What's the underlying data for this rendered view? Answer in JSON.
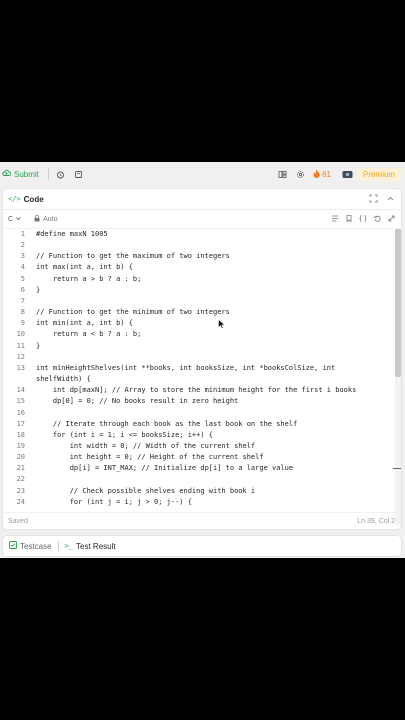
{
  "toolbar": {
    "submit_label": "Submit",
    "streak_count": "61",
    "premium_label": "Premium"
  },
  "panel": {
    "title": "Code",
    "language": "C",
    "indent_mode": "Auto"
  },
  "editor": {
    "lines": [
      {
        "n": "1",
        "t": "#define maxN 1005"
      },
      {
        "n": "2",
        "t": ""
      },
      {
        "n": "3",
        "t": "// Function to get the maximum of two integers"
      },
      {
        "n": "4",
        "t": "int max(int a, int b) {"
      },
      {
        "n": "5",
        "t": "    return a > b ? a : b;"
      },
      {
        "n": "6",
        "t": "}"
      },
      {
        "n": "7",
        "t": ""
      },
      {
        "n": "8",
        "t": "// Function to get the minimum of two integers"
      },
      {
        "n": "9",
        "t": "int min(int a, int b) {"
      },
      {
        "n": "10",
        "t": "    return a < b ? a : b;"
      },
      {
        "n": "11",
        "t": "}"
      },
      {
        "n": "12",
        "t": ""
      },
      {
        "n": "13",
        "t": "int minHeightShelves(int **books, int booksSize, int *booksColSize, int"
      },
      {
        "n": "",
        "t": "shelfWidth) {"
      },
      {
        "n": "14",
        "t": "    int dp[maxN]; // Array to store the minimum height for the first i books"
      },
      {
        "n": "15",
        "t": "    dp[0] = 0; // No books result in zero height"
      },
      {
        "n": "16",
        "t": ""
      },
      {
        "n": "17",
        "t": "    // Iterate through each book as the last book on the shelf"
      },
      {
        "n": "18",
        "t": "    for (int i = 1; i <= booksSize; i++) {"
      },
      {
        "n": "19",
        "t": "        int width = 0; // Width of the current shelf"
      },
      {
        "n": "20",
        "t": "        int height = 0; // Height of the current shelf"
      },
      {
        "n": "21",
        "t": "        dp[i] = INT_MAX; // Initialize dp[i] to a large value"
      },
      {
        "n": "22",
        "t": ""
      },
      {
        "n": "23",
        "t": "        // Check possible shelves ending with book i"
      },
      {
        "n": "24",
        "t": "        for (int j = i; j > 0; j--) {"
      }
    ]
  },
  "status": {
    "saved": "Saved",
    "cursor_position": "Ln 39, Col 2"
  },
  "bottom_tabs": [
    "Testcase",
    "Test Result"
  ],
  "colors": {
    "accent_green": "#2aa44f",
    "premium_orange": "#f5a623",
    "streak_orange": "#ff7a1a"
  }
}
